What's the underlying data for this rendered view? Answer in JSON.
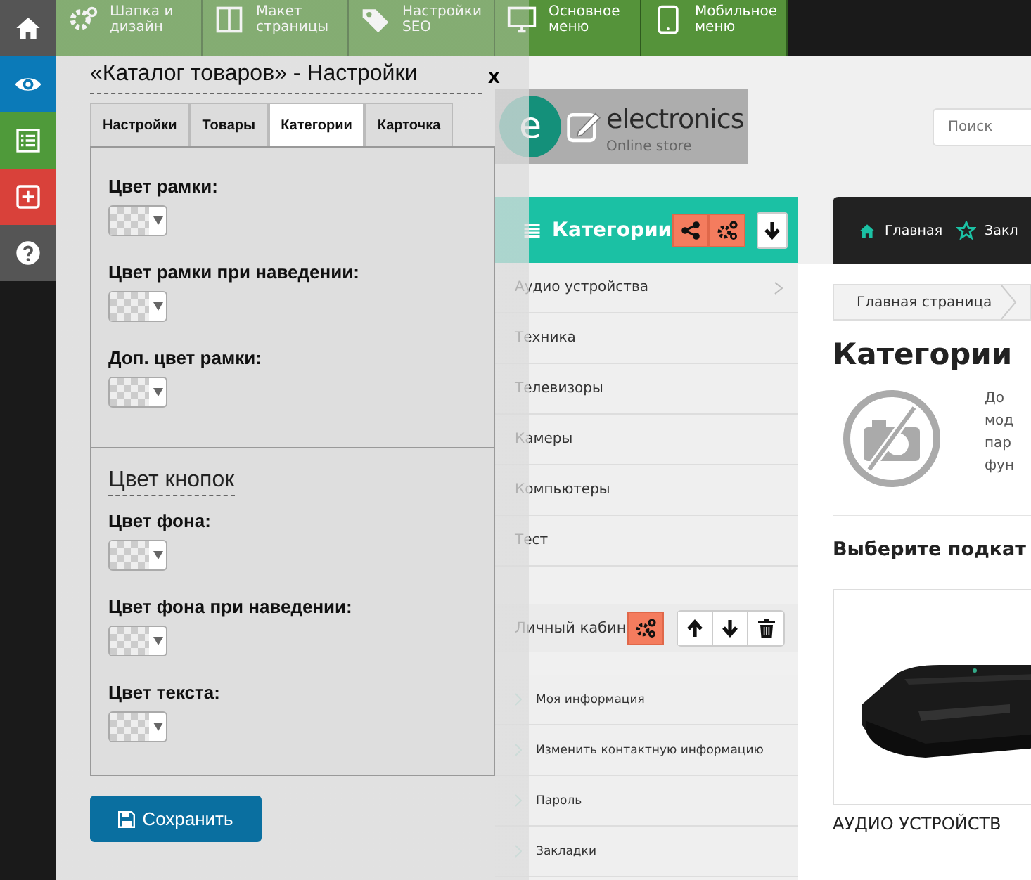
{
  "sidebar_icons": [
    {
      "kind": "home",
      "color": "#555555"
    },
    {
      "kind": "eye",
      "color": "#0b7ab8"
    },
    {
      "kind": "list",
      "color": "#4f9a3a"
    },
    {
      "kind": "plus",
      "color": "#d9413a"
    },
    {
      "kind": "help",
      "color": "#555555"
    }
  ],
  "top_menu": [
    {
      "label": "Шапка и дизайн",
      "kind": "gears"
    },
    {
      "label": "Макет страницы",
      "kind": "layout"
    },
    {
      "label": "Настройки SEO",
      "kind": "tag"
    },
    {
      "label": "Основное меню",
      "kind": "monitor"
    },
    {
      "label": "Мобильное меню",
      "kind": "tablet"
    }
  ],
  "logo": {
    "letter": "e",
    "name": "electronics",
    "tagline": "Online store"
  },
  "search": {
    "placeholder": "Поиск"
  },
  "categories_block": {
    "title": "Категории",
    "items": [
      {
        "label": "Аудио устройства",
        "has_children": true
      },
      {
        "label": "Техника",
        "has_children": false
      },
      {
        "label": "Телевизоры",
        "has_children": false
      },
      {
        "label": "Камеры",
        "has_children": false
      },
      {
        "label": "Компьютеры",
        "has_children": false
      },
      {
        "label": "Тест",
        "has_children": false
      }
    ]
  },
  "account_block": {
    "title": "Личный кабин",
    "items": [
      "Моя информация",
      "Изменить контактную информацию",
      "Пароль",
      "Закладки"
    ]
  },
  "nav": [
    {
      "label": "Главная",
      "kind": "home"
    },
    {
      "label": "Закл",
      "kind": "star"
    }
  ],
  "breadcrumb": [
    "Главная страница"
  ],
  "heading": "Категории",
  "description_lines": [
    "До",
    "мод",
    "пар",
    "фун"
  ],
  "subheading": "Выберите подкат",
  "products": [
    {
      "title": "АУДИО УСТРОЙСТВ"
    }
  ],
  "panel": {
    "title": "«Каталог товаров» - Настройки",
    "close": "x",
    "tabs": [
      {
        "label": "Настройки",
        "selected": false
      },
      {
        "label": "Товары",
        "selected": false
      },
      {
        "label": "Категории",
        "selected": true
      },
      {
        "label": "Карточка",
        "selected": false
      }
    ],
    "sections": [
      {
        "fields": [
          "Цвет рамки:",
          "Цвет рамки при наведении:",
          "Доп. цвет рамки:"
        ]
      },
      {
        "heading": "Цвет кнопок",
        "fields": [
          "Цвет фона:",
          "Цвет фона при наведении:",
          "Цвет текста:"
        ]
      }
    ],
    "save": "Сохранить"
  }
}
